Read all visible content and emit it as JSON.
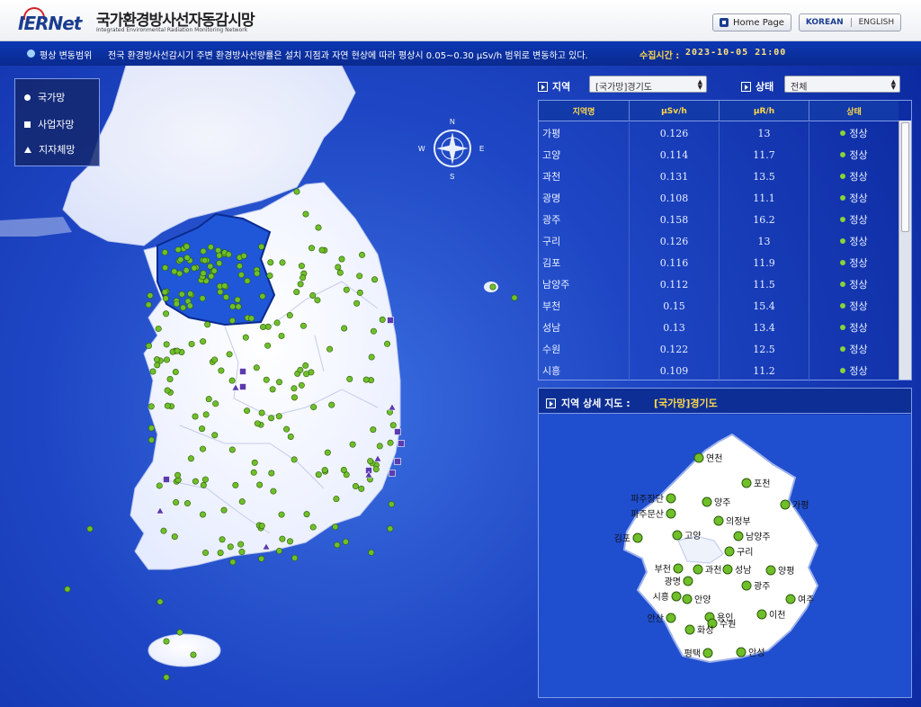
{
  "header": {
    "logo": "IERNet",
    "title": "국가환경방사선자동감시망",
    "subtitle": "Integrated Environmental Radiation Monitoring Network",
    "home_button": "Home Page",
    "lang_korean": "KOREAN",
    "lang_english": "ENGLISH"
  },
  "infobar": {
    "label": "평상 변동범위",
    "text": "전국 환경방사선감시기 주변 환경방사선량률은 설치 지점과 자연 현상에 따라 평상시 0.05~0.30 μSv/h 범위로 변동하고 있다.",
    "time_label": "수집시간 :",
    "time_value": "2023-10-05 21:00"
  },
  "legend": {
    "national": "국가망",
    "operator": "사업자망",
    "local": "지자체망"
  },
  "compass": {
    "n": "N",
    "e": "E",
    "s": "S",
    "w": "W"
  },
  "filters": {
    "region_label": "지역",
    "region_value": "[국가망]경기도",
    "status_label": "상태",
    "status_value": "전체"
  },
  "table": {
    "headers": [
      "지역명",
      "μSv/h",
      "μR/h",
      "상태"
    ],
    "rows": [
      {
        "name": "가평",
        "usv": "0.126",
        "ur": "13",
        "status": "정상"
      },
      {
        "name": "고양",
        "usv": "0.114",
        "ur": "11.7",
        "status": "정상"
      },
      {
        "name": "과천",
        "usv": "0.131",
        "ur": "13.5",
        "status": "정상"
      },
      {
        "name": "광명",
        "usv": "0.108",
        "ur": "11.1",
        "status": "정상"
      },
      {
        "name": "광주",
        "usv": "0.158",
        "ur": "16.2",
        "status": "정상"
      },
      {
        "name": "구리",
        "usv": "0.126",
        "ur": "13",
        "status": "정상"
      },
      {
        "name": "김포",
        "usv": "0.116",
        "ur": "11.9",
        "status": "정상"
      },
      {
        "name": "남양주",
        "usv": "0.112",
        "ur": "11.5",
        "status": "정상"
      },
      {
        "name": "부천",
        "usv": "0.15",
        "ur": "15.4",
        "status": "정상"
      },
      {
        "name": "성남",
        "usv": "0.13",
        "ur": "13.4",
        "status": "정상"
      },
      {
        "name": "수원",
        "usv": "0.122",
        "ur": "12.5",
        "status": "정상"
      },
      {
        "name": "시흥",
        "usv": "0.109",
        "ur": "11.2",
        "status": "정상"
      }
    ]
  },
  "detail": {
    "title": "지역 상세 지도 :",
    "region": "[국가망]경기도",
    "stations": [
      "연천",
      "포천",
      "가평",
      "파주장단",
      "파주문산",
      "양주",
      "의정부",
      "남양주",
      "김포",
      "고양",
      "구리",
      "양평",
      "부천",
      "과천",
      "성남",
      "광명",
      "광주",
      "여주",
      "시흥",
      "안양",
      "이천",
      "안산",
      "용인",
      "수원",
      "화성",
      "평택",
      "안성"
    ]
  },
  "colors": {
    "header_bar": "#0c37b5",
    "time_text": "#ffe27a",
    "station_green": "#6fbf2a",
    "network_purple": "#5a3bb0"
  }
}
